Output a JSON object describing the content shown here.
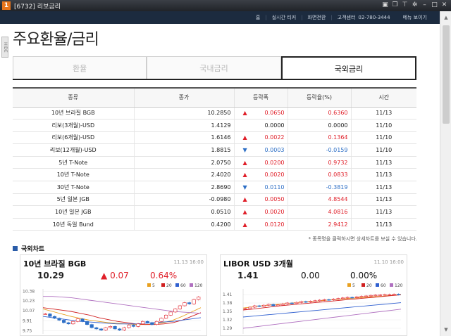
{
  "window": {
    "app_icon": "1",
    "title": "[6732]  리보금리"
  },
  "navbar": {
    "home": "홈",
    "realtime": "실시간 티커",
    "switch_screen": "화면전환",
    "support_label": "고객센터",
    "support_phone": "02-780-3444",
    "menu": "메뉴 보이기"
  },
  "hide_tab": "HIDE",
  "page_title": "주요환율/금리",
  "tabs": [
    {
      "label": "환율",
      "active": false
    },
    {
      "label": "국내금리",
      "active": false
    },
    {
      "label": "국외금리",
      "active": true
    }
  ],
  "table": {
    "headers": [
      "종류",
      "종가",
      "등락폭",
      "등락율(%)",
      "시간"
    ],
    "rows": [
      {
        "name": "10년 브라질 BGB",
        "close": "10.2850",
        "dir": "up",
        "change": "0.0650",
        "pct": "0.6360",
        "time": "11/13"
      },
      {
        "name": "리보(3개월)-USD",
        "close": "1.4129",
        "dir": "none",
        "change": "0.0000",
        "pct": "0.0000",
        "time": "11/10"
      },
      {
        "name": "리보(6개월)-USD",
        "close": "1.6146",
        "dir": "up",
        "change": "0.0022",
        "pct": "0.1364",
        "time": "11/10"
      },
      {
        "name": "리보(12개월)-USD",
        "close": "1.8815",
        "dir": "down",
        "change": "0.0003",
        "pct": "-0.0159",
        "time": "11/10"
      },
      {
        "name": "5년 T-Note",
        "close": "2.0750",
        "dir": "up",
        "change": "0.0200",
        "pct": "0.9732",
        "time": "11/13"
      },
      {
        "name": "10년 T-Note",
        "close": "2.4020",
        "dir": "up",
        "change": "0.0020",
        "pct": "0.0833",
        "time": "11/13"
      },
      {
        "name": "30년 T-Note",
        "close": "2.8690",
        "dir": "down",
        "change": "0.0110",
        "pct": "-0.3819",
        "time": "11/13"
      },
      {
        "name": "5년 일본 JGB",
        "close": "-0.0980",
        "dir": "up",
        "change": "0.0050",
        "pct": "4.8544",
        "time": "11/13"
      },
      {
        "name": "10년 일본 JGB",
        "close": "0.0510",
        "dir": "up",
        "change": "0.0020",
        "pct": "4.0816",
        "time": "11/13"
      },
      {
        "name": "10년 독일 Bund",
        "close": "0.4200",
        "dir": "up",
        "change": "0.0120",
        "pct": "2.9412",
        "time": "11/13"
      }
    ]
  },
  "note": "* 종목명을 클릭하시면 상세차트를 보실 수 있습니다.",
  "section_title": "국외차트",
  "legend": [
    "5",
    "20",
    "60",
    "120"
  ],
  "legend_colors": [
    "#e8a020",
    "#d02020",
    "#3060d0",
    "#b070c0"
  ],
  "charts": [
    {
      "title": "10년 브라질 BGB",
      "date": "11.13 16:00",
      "price": "10.29",
      "change_arrow": "▲",
      "change": "0.07",
      "pct": "0.64%",
      "change_color": "#e0202a",
      "yticks": [
        "10.38",
        "10.23",
        "10.07",
        "9.91",
        "9.75"
      ],
      "ymin": 9.7,
      "ymax": 10.42,
      "candles": [
        10.02,
        9.98,
        9.95,
        9.92,
        9.88,
        9.86,
        9.9,
        9.94,
        9.9,
        9.85,
        9.8,
        9.78,
        9.76,
        9.8,
        9.82,
        9.78,
        9.76,
        9.8,
        9.84,
        9.82,
        9.86,
        9.9,
        9.88,
        9.85,
        9.9,
        9.95,
        10.0,
        10.05,
        10.1,
        10.15,
        10.2,
        10.18,
        10.25,
        10.29
      ],
      "ma": [
        [
          10.1,
          10.06,
          10.02,
          9.98,
          9.95,
          9.92,
          9.9,
          9.88,
          9.87,
          9.86,
          9.85,
          9.85,
          9.86,
          9.88,
          9.92,
          9.98,
          10.05,
          10.12
        ],
        [
          10.12,
          10.1,
          10.08,
          10.06,
          10.03,
          10.0,
          9.96,
          9.93,
          9.9,
          9.88,
          9.86,
          9.85,
          9.85,
          9.86,
          9.88,
          9.92,
          9.98,
          10.04
        ],
        [
          9.98,
          9.96,
          9.94,
          9.92,
          9.9,
          9.89,
          9.88,
          9.87,
          9.86,
          9.86,
          9.86,
          9.87,
          9.88,
          9.89,
          9.9,
          9.92,
          9.94,
          9.96
        ],
        [
          10.3,
          10.3,
          10.29,
          10.28,
          10.26,
          10.24,
          10.22,
          10.2,
          10.18,
          10.16,
          10.14,
          10.12,
          10.1,
          10.08,
          10.06,
          10.05,
          10.04,
          10.03
        ]
      ]
    },
    {
      "title": "LIBOR USD 3개월",
      "date": "11.10 16:00",
      "price": "1.41",
      "change_arrow": "",
      "change": "0.00",
      "pct": "0.00%",
      "change_color": "#111111",
      "yticks": [
        "1.41",
        "1.38",
        "1.35",
        "1.32",
        "1.29"
      ],
      "ymin": 1.27,
      "ymax": 1.43,
      "candles": [
        1.36,
        1.365,
        1.37,
        1.368,
        1.372,
        1.375,
        1.37,
        1.373,
        1.377,
        1.38,
        1.378,
        1.382,
        1.385,
        1.383,
        1.386,
        1.388,
        1.39,
        1.392,
        1.391,
        1.394,
        1.396,
        1.398,
        1.4,
        1.399,
        1.402,
        1.404,
        1.405,
        1.407,
        1.408,
        1.409,
        1.41,
        1.41,
        1.411,
        1.41
      ],
      "ma": [
        [
          1.362,
          1.366,
          1.37,
          1.373,
          1.376,
          1.379,
          1.382,
          1.385,
          1.387,
          1.39,
          1.392,
          1.395,
          1.397,
          1.4,
          1.402,
          1.404,
          1.407,
          1.41
        ],
        [
          1.355,
          1.358,
          1.362,
          1.366,
          1.37,
          1.373,
          1.376,
          1.379,
          1.382,
          1.385,
          1.388,
          1.391,
          1.394,
          1.397,
          1.4,
          1.403,
          1.406,
          1.409
        ],
        [
          1.33,
          1.333,
          1.336,
          1.339,
          1.342,
          1.345,
          1.348,
          1.351,
          1.354,
          1.357,
          1.36,
          1.363,
          1.366,
          1.369,
          1.372,
          1.375,
          1.378,
          1.381
        ],
        [
          1.29,
          1.294,
          1.298,
          1.302,
          1.306,
          1.31,
          1.314,
          1.318,
          1.322,
          1.326,
          1.33,
          1.334,
          1.338,
          1.342,
          1.346,
          1.35,
          1.354,
          1.358
        ]
      ]
    }
  ]
}
